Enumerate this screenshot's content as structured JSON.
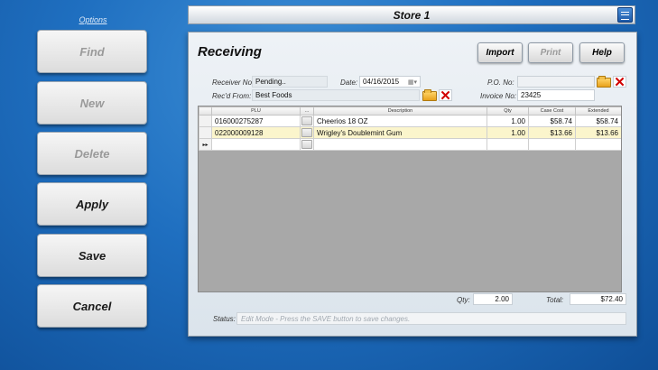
{
  "sidebar": {
    "options_label": "Options",
    "buttons": [
      {
        "label": "Find",
        "enabled": false
      },
      {
        "label": "New",
        "enabled": false
      },
      {
        "label": "Delete",
        "enabled": false
      },
      {
        "label": "Apply",
        "enabled": true
      },
      {
        "label": "Save",
        "enabled": true
      },
      {
        "label": "Cancel",
        "enabled": true
      }
    ]
  },
  "titlebar": {
    "title": "Store 1",
    "icon": "register-icon"
  },
  "panel": {
    "title": "Receiving",
    "buttons": [
      {
        "label": "Import",
        "enabled": true
      },
      {
        "label": "Print",
        "enabled": false
      },
      {
        "label": "Help",
        "enabled": true
      }
    ]
  },
  "form": {
    "receiver_no_label": "Receiver No:",
    "receiver_no_value": "Pending..",
    "date_label": "Date:",
    "date_value": "04/16/2015",
    "po_no_label": "P.O. No:",
    "po_no_value": "",
    "recd_from_label": "Rec'd From:",
    "recd_from_value": "Best Foods",
    "invoice_no_label": "Invoice No:",
    "invoice_no_value": "23425"
  },
  "grid": {
    "columns": [
      "PLU",
      "...",
      "Description",
      "Qty",
      "Case Cost",
      "Extended"
    ],
    "rows": [
      {
        "plu": "016000275287",
        "description": "Cheerios 18 OZ",
        "qty": "1.00",
        "case_cost": "$58.74",
        "extended": "$58.74"
      },
      {
        "plu": "022000009128",
        "description": "Wrigley's Doublemint Gum",
        "qty": "1.00",
        "case_cost": "$13.66",
        "extended": "$13.66"
      }
    ],
    "new_row_marker": "▸▸"
  },
  "totals": {
    "qty_label": "Qty:",
    "qty_value": "2.00",
    "total_label": "Total:",
    "total_value": "$72.40"
  },
  "status": {
    "label": "Status:",
    "text": "Edit Mode - Press the SAVE button to save changes."
  },
  "colors": {
    "background": "#1f6fc0",
    "selected_row": "#fbf5cc",
    "delete_red": "#d10000"
  }
}
